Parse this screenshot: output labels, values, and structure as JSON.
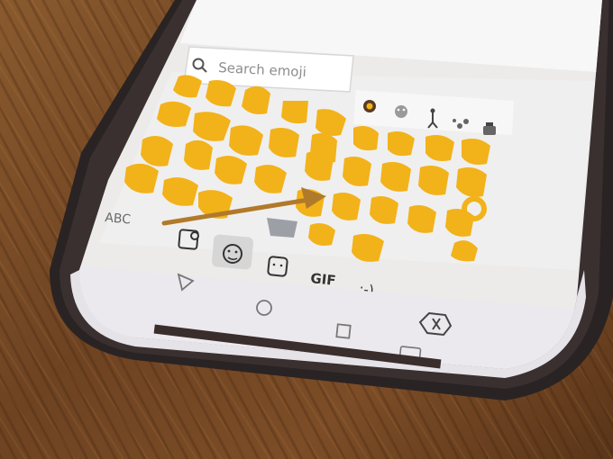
{
  "search": {
    "placeholder": "Search emoji"
  },
  "keyboard": {
    "abc_label": "ABC",
    "gif_label": "GIF",
    "emoticon_label": ":-)"
  },
  "colors": {
    "emoji_yellow": "#f2b21a",
    "screen_bg": "#ecebea",
    "phone_body": "#2a2323",
    "arrow": "#b07a2a",
    "wood": "#7c4d27"
  },
  "icons": {
    "search": "search-icon",
    "recent": "recent-clock-icon",
    "smileys": "smiley-category-icon",
    "people": "people-category-icon",
    "animals": "animals-category-icon",
    "food": "food-category-icon",
    "sticker": "sticker-icon",
    "emoji": "emoji-tab-icon",
    "back": "nav-back-icon",
    "home": "nav-home-icon",
    "recents": "nav-recents-icon",
    "delete": "backspace-icon",
    "keyboard": "keyboard-hide-icon"
  }
}
